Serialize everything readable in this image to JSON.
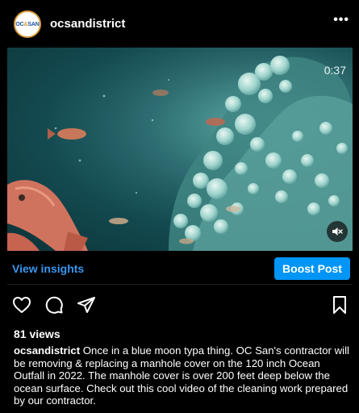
{
  "post": {
    "username": "ocsandistrict",
    "avatar_logo": {
      "oc": "OC",
      "amp": "&",
      "san": "SAN"
    },
    "more_icon": "ellipsis-icon",
    "video": {
      "duration": "0:37",
      "mute_icon": "speaker-muted-icon"
    },
    "insights_label": "View insights",
    "boost_label": "Boost Post",
    "actions": [
      "heart-icon",
      "comment-icon",
      "share-icon",
      "bookmark-icon"
    ],
    "views": "81 views",
    "caption_user": "ocsandistrict",
    "caption_text": " Once in a blue moon typa thing. OC San's contractor will be removing & replacing a manhole cover on the 120 inch Ocean Outfall in 2022. The manhole cover is over 200 feet deep below the ocean surface. Check out this cool video of the cleaning work prepared by our contractor."
  },
  "colors": {
    "background": "#000000",
    "link_blue": "#3897f0",
    "boost_blue": "#0095f6",
    "water_teal": "#2a6d72"
  }
}
